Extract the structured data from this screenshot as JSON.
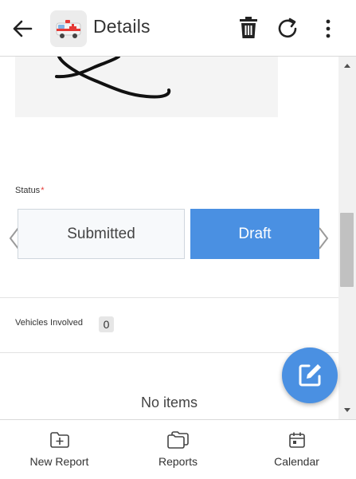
{
  "header": {
    "title": "Details"
  },
  "form": {
    "status_label": "Status",
    "status_required_marker": "*",
    "status_options": [
      {
        "label": "Submitted",
        "selected": false
      },
      {
        "label": "Draft",
        "selected": true
      }
    ],
    "vehicles_label": "Vehicles Involved",
    "vehicles_count": "0",
    "empty_list_text": "No items"
  },
  "bottom_nav": {
    "items": [
      {
        "label": "New Report",
        "icon": "folder-add-icon"
      },
      {
        "label": "Reports",
        "icon": "folders-icon"
      },
      {
        "label": "Calendar",
        "icon": "calendar-icon"
      }
    ]
  },
  "colors": {
    "accent": "#4a90e2",
    "required": "#e53935"
  }
}
